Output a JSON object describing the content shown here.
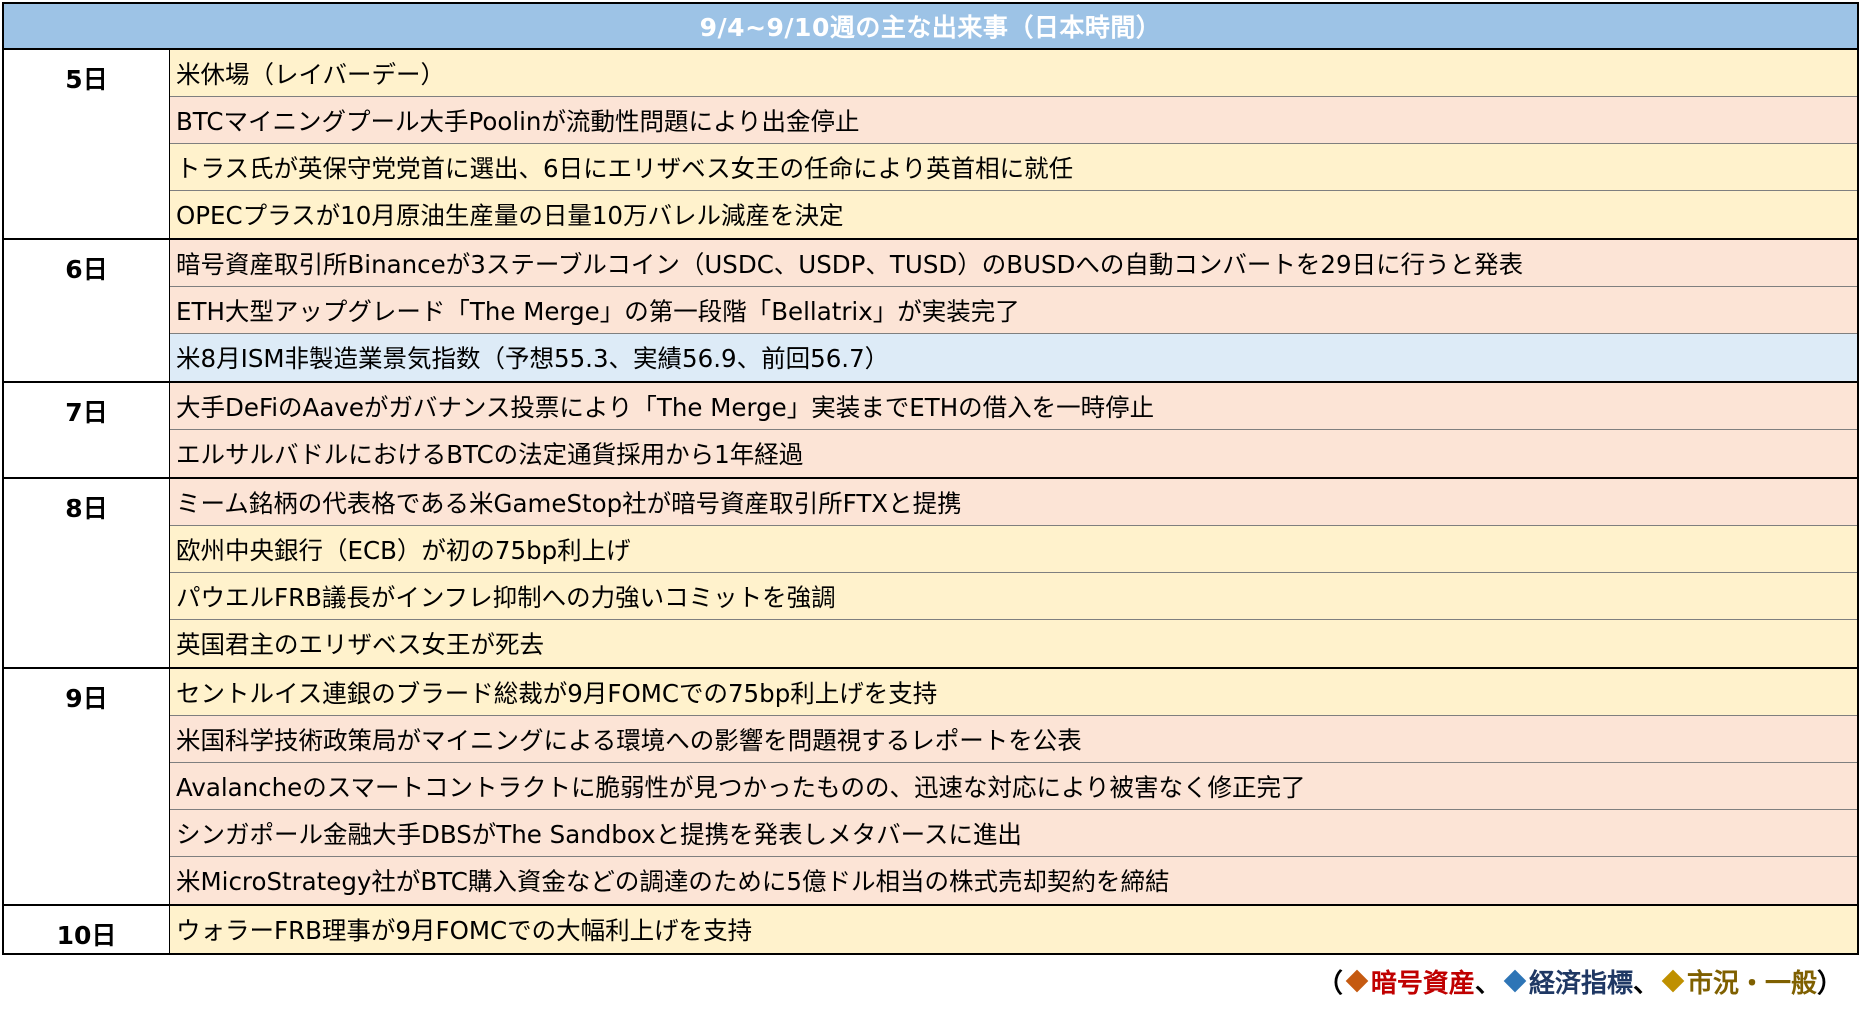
{
  "title": "9/4~9/10週の主な出来事（日本時間）",
  "colors": {
    "header_bg": "#9dc3e6",
    "crypto_bg": "#fce4d6",
    "econ_bg": "#ddebf7",
    "general_bg": "#fff2cc",
    "crypto_marker": "#c55a11",
    "econ_marker": "#2e75b6",
    "general_marker": "#bf9000"
  },
  "groups": [
    {
      "day": "5日",
      "events": [
        {
          "text": "米休場（レイバーデー）",
          "category": "general"
        },
        {
          "text": "BTCマイニングプール大手Poolinが流動性問題により出金停止",
          "category": "crypto"
        },
        {
          "text": "トラス氏が英保守党党首に選出、6日にエリザベス女王の任命により英首相に就任",
          "category": "general"
        },
        {
          "text": "OPECプラスが10月原油生産量の日量10万バレル減産を決定",
          "category": "general"
        }
      ]
    },
    {
      "day": "6日",
      "events": [
        {
          "text": "暗号資産取引所Binanceが3ステーブルコイン（USDC、USDP、TUSD）のBUSDへの自動コンバートを29日に行うと発表",
          "category": "crypto"
        },
        {
          "text": "ETH大型アップグレード「The Merge」の第一段階「Bellatrix」が実装完了",
          "category": "crypto"
        },
        {
          "text": "米8月ISM非製造業景気指数（予想55.3、実績56.9、前回56.7）",
          "category": "econ"
        }
      ]
    },
    {
      "day": "7日",
      "events": [
        {
          "text": "大手DeFiのAaveがガバナンス投票により「The Merge」実装までETHの借入を一時停止",
          "category": "crypto"
        },
        {
          "text": "エルサルバドルにおけるBTCの法定通貨採用から1年経過",
          "category": "crypto"
        }
      ]
    },
    {
      "day": "8日",
      "events": [
        {
          "text": "ミーム銘柄の代表格である米GameStop社が暗号資産取引所FTXと提携",
          "category": "crypto"
        },
        {
          "text": "欧州中央銀行（ECB）が初の75bp利上げ",
          "category": "general"
        },
        {
          "text": "パウエルFRB議長がインフレ抑制への力強いコミットを強調",
          "category": "general"
        },
        {
          "text": "英国君主のエリザベス女王が死去",
          "category": "general"
        }
      ]
    },
    {
      "day": "9日",
      "events": [
        {
          "text": "セントルイス連銀のブラード総裁が9月FOMCでの75bp利上げを支持",
          "category": "general"
        },
        {
          "text": "米国科学技術政策局がマイニングによる環境への影響を問題視するレポートを公表",
          "category": "crypto"
        },
        {
          "text": "Avalancheのスマートコントラクトに脆弱性が見つかったものの、迅速な対応により被害なく修正完了",
          "category": "crypto"
        },
        {
          "text": "シンガポール金融大手DBSがThe Sandboxと提携を発表しメタバースに進出",
          "category": "crypto"
        },
        {
          "text": "米MicroStrategy社がBTC購入資金などの調達のために5億ドル相当の株式売却契約を締結",
          "category": "crypto"
        }
      ]
    },
    {
      "day": "10日",
      "events": [
        {
          "text": "ウォラーFRB理事が9月FOMCでの大幅利上げを支持",
          "category": "general"
        }
      ]
    }
  ],
  "legend": {
    "open": "（",
    "crypto": "暗号資産",
    "sep1": "、",
    "econ": "経済指標",
    "sep2": "、",
    "general": "市況・一般",
    "close": "）"
  }
}
